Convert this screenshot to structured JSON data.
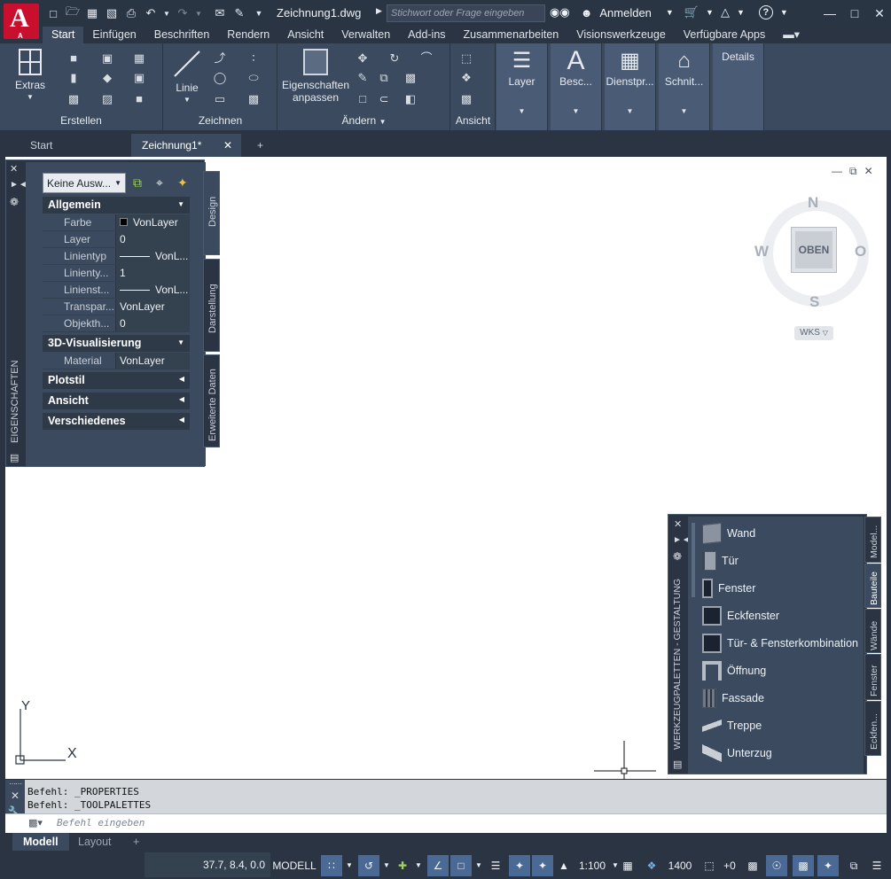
{
  "app": {
    "logo_letter": "A",
    "logo_small": "A",
    "document_title": "Zeichnung1.dwg",
    "search_placeholder": "Stichwort oder Frage eingeben",
    "signin": "Anmelden",
    "brand_color": "#c8102e",
    "accent": "#4a6a95"
  },
  "qat": [
    "new-icon",
    "open-icon",
    "save-icon",
    "saveas-icon",
    "print-icon",
    "undo-icon",
    "redo-icon",
    "share-icon",
    "publish-icon",
    "dropdown-icon"
  ],
  "ribbon_tabs": [
    "Start",
    "Einfügen",
    "Beschriften",
    "Rendern",
    "Ansicht",
    "Verwalten",
    "Add-ins",
    "Zusammenarbeiten",
    "Visionswerkzeuge",
    "Verfügbare Apps"
  ],
  "ribbon": {
    "extras": "Extras",
    "panel_erstellen": "Erstellen",
    "linie": "Linie",
    "panel_zeichnen": "Zeichnen",
    "eigenschaften_l1": "Eigenschaften",
    "eigenschaften_l2": "anpassen",
    "panel_aendern": "Ändern",
    "panel_ansicht": "Ansicht",
    "layer": "Layer",
    "besc": "Besc...",
    "dienstpr": "Dienstpr...",
    "schnit": "Schnit...",
    "details": "Details"
  },
  "doc_tabs": {
    "start": "Start",
    "current": "Zeichnung1*",
    "add": "+",
    "close": "✕"
  },
  "properties": {
    "title": "EIGENSCHAFTEN",
    "selection": "Keine Ausw...",
    "tabs": [
      "Design",
      "Darstellung",
      "Erweiterte Daten"
    ],
    "section_general": "Allgemein",
    "rows_general": [
      {
        "label": "Farbe",
        "value": "VonLayer"
      },
      {
        "label": "Layer",
        "value": "0"
      },
      {
        "label": "Linientyp",
        "value": "VonL..."
      },
      {
        "label": "Linienty...",
        "value": "1"
      },
      {
        "label": "Linienst...",
        "value": "VonL..."
      },
      {
        "label": "Transpar...",
        "value": "VonLayer"
      },
      {
        "label": "Objekth...",
        "value": "0"
      }
    ],
    "section_3d": "3D-Visualisierung",
    "rows_3d": [
      {
        "label": "Material",
        "value": "VonLayer"
      }
    ],
    "section_plotstil": "Plotstil",
    "section_ansicht": "Ansicht",
    "section_verschiedenes": "Verschiedenes"
  },
  "viewcube": {
    "n": "N",
    "s": "S",
    "w": "W",
    "o": "O",
    "face": "OBEN",
    "wcs": "WKS"
  },
  "ucs": {
    "x": "X",
    "y": "Y"
  },
  "toolpalette": {
    "title": "WERKZEUGPALETTEN - GESTALTUNG",
    "tabs": [
      "Model...",
      "Bauteile",
      "Wände",
      "Fenster",
      "Eckfen..."
    ],
    "items": [
      "Wand",
      "Tür",
      "Fenster",
      "Eckfenster",
      "Tür- & Fensterkombination",
      "Öffnung",
      "Fassade",
      "Treppe",
      "Unterzug"
    ]
  },
  "command": {
    "history": [
      "Befehl: _PROPERTIES",
      "Befehl: _TOOLPALETTES"
    ],
    "placeholder": "Befehl eingeben"
  },
  "layout_tabs": {
    "model": "Modell",
    "layout": "Layout",
    "add": "+"
  },
  "status": {
    "coords": "37.7, 8.4, 0.0",
    "mode": "MODELL",
    "scale": "1:100",
    "layer_count": "1400",
    "plus": "+0"
  }
}
